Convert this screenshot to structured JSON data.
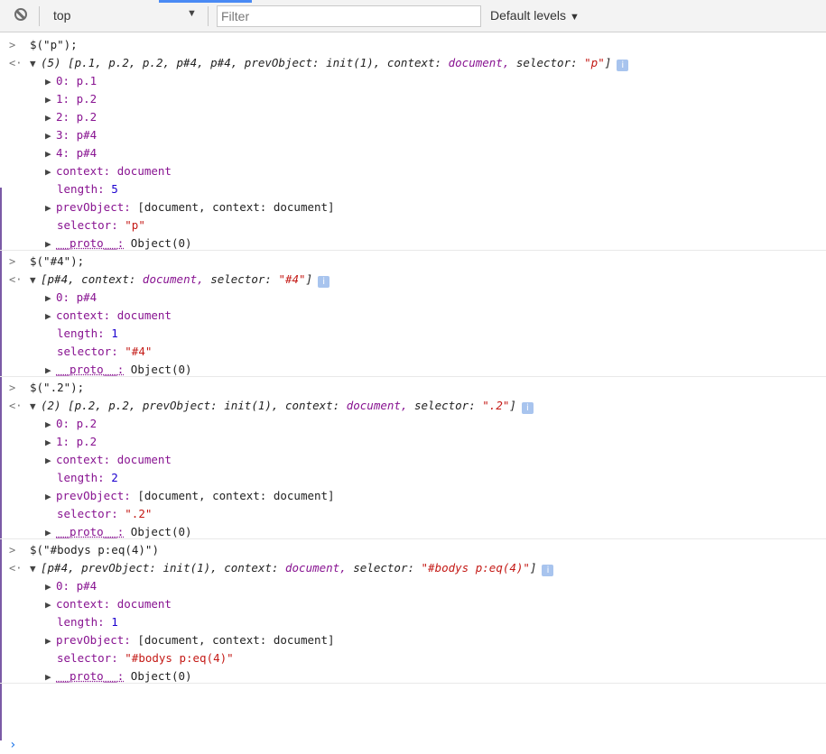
{
  "toolbar": {
    "context": "top",
    "filter_placeholder": "Filter",
    "levels": "Default levels"
  },
  "console": [
    {
      "command": "$(\"p\");",
      "summary_count": "(5)",
      "summary_items": "p.1, p.2, p.2, p#4, p#4,",
      "summary_rest": [
        {
          "key": "prevObject:",
          "val": "init(1),"
        },
        {
          "key": "context:",
          "val": "document,"
        },
        {
          "key": "selector:",
          "val": "\"p\""
        }
      ],
      "items": [
        {
          "expandable": true,
          "key": "0:",
          "val": "p.1"
        },
        {
          "expandable": true,
          "key": "1:",
          "val": "p.2"
        },
        {
          "expandable": true,
          "key": "2:",
          "val": "p.2"
        },
        {
          "expandable": true,
          "key": "3:",
          "val": "p#4"
        },
        {
          "expandable": true,
          "key": "4:",
          "val": "p#4"
        },
        {
          "expandable": true,
          "key": "context:",
          "val": "document"
        },
        {
          "expandable": false,
          "key": "length:",
          "val": "5"
        },
        {
          "expandable": true,
          "key": "prevObject:",
          "val": "[document, context: document]"
        },
        {
          "expandable": false,
          "key": "selector:",
          "val": "\"p\""
        },
        {
          "expandable": true,
          "key": "__proto__:",
          "val": "Object(0)"
        }
      ]
    },
    {
      "command": "$(\"#4\");",
      "summary_count": "",
      "summary_items": "p#4,",
      "summary_rest": [
        {
          "key": "context:",
          "val": "document,"
        },
        {
          "key": "selector:",
          "val": "\"#4\""
        }
      ],
      "items": [
        {
          "expandable": true,
          "key": "0:",
          "val": "p#4"
        },
        {
          "expandable": true,
          "key": "context:",
          "val": "document"
        },
        {
          "expandable": false,
          "key": "length:",
          "val": "1"
        },
        {
          "expandable": false,
          "key": "selector:",
          "val": "\"#4\""
        },
        {
          "expandable": true,
          "key": "__proto__:",
          "val": "Object(0)"
        }
      ]
    },
    {
      "command": "$(\".2\");",
      "summary_count": "(2)",
      "summary_items": "p.2, p.2,",
      "summary_rest": [
        {
          "key": "prevObject:",
          "val": "init(1),"
        },
        {
          "key": "context:",
          "val": "document,"
        },
        {
          "key": "selector:",
          "val": "\".2\""
        }
      ],
      "items": [
        {
          "expandable": true,
          "key": "0:",
          "val": "p.2"
        },
        {
          "expandable": true,
          "key": "1:",
          "val": "p.2"
        },
        {
          "expandable": true,
          "key": "context:",
          "val": "document"
        },
        {
          "expandable": false,
          "key": "length:",
          "val": "2"
        },
        {
          "expandable": true,
          "key": "prevObject:",
          "val": "[document, context: document]"
        },
        {
          "expandable": false,
          "key": "selector:",
          "val": "\".2\""
        },
        {
          "expandable": true,
          "key": "__proto__:",
          "val": "Object(0)"
        }
      ]
    },
    {
      "command": "$(\"#bodys p:eq(4)\")",
      "summary_count": "",
      "summary_items": "p#4,",
      "summary_rest": [
        {
          "key": "prevObject:",
          "val": "init(1),"
        },
        {
          "key": "context:",
          "val": "document,"
        },
        {
          "key": "selector:",
          "val": "\"#bodys p:eq(4)\""
        }
      ],
      "items": [
        {
          "expandable": true,
          "key": "0:",
          "val": "p#4"
        },
        {
          "expandable": true,
          "key": "context:",
          "val": "document"
        },
        {
          "expandable": false,
          "key": "length:",
          "val": "1"
        },
        {
          "expandable": true,
          "key": "prevObject:",
          "val": "[document, context: document]"
        },
        {
          "expandable": false,
          "key": "selector:",
          "val": "\"#bodys p:eq(4)\""
        },
        {
          "expandable": true,
          "key": "__proto__:",
          "val": "Object(0)"
        }
      ]
    }
  ],
  "glyphs": {
    "input_prompt": ">",
    "output_marker": "<·",
    "expanded": "▼",
    "collapsed": "▶",
    "dropdown": "▼",
    "info": "i",
    "array_open": "[",
    "array_close": "]",
    "active_prompt": "›"
  },
  "colors": {
    "keyword": "#881391",
    "string": "#c41a16",
    "number": "#1c00cf",
    "info_badge": "#a8c4ee",
    "prompt": "#1a73e8"
  }
}
